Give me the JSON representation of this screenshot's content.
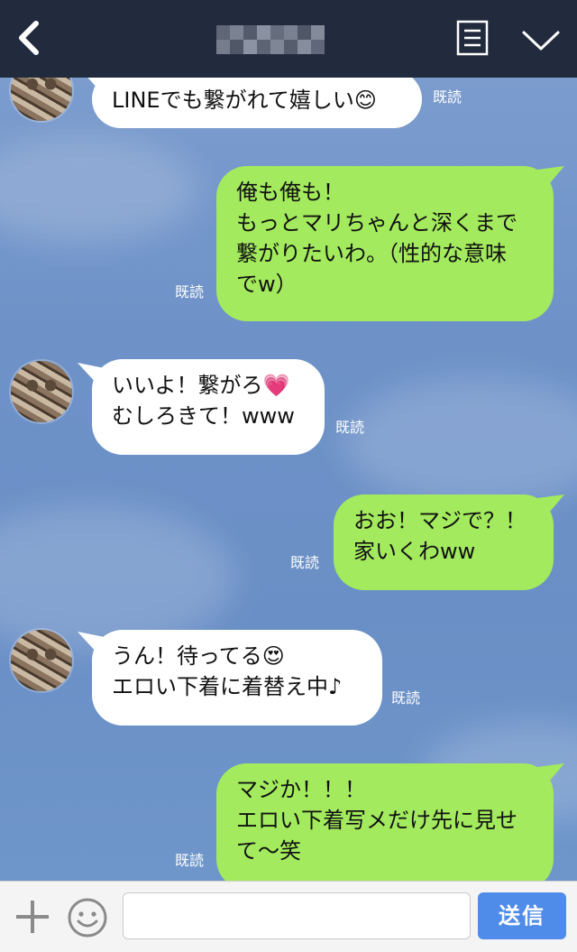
{
  "header": {
    "title": "",
    "colors": {
      "background": "#222a3d",
      "icon": "#ffffff"
    },
    "icons": [
      "back-chevron-icon",
      "note-menu-icon",
      "chevron-down-icon"
    ]
  },
  "messages": [
    {
      "side": "in",
      "lines": [
        "LINEでも繋がれて嬉しい😊"
      ],
      "read": "既読"
    },
    {
      "side": "out",
      "lines": [
        "俺も俺も！",
        "もっとマリちゃんと深くまで",
        "繋がりたいわ。（性的な意味",
        "でw）"
      ],
      "read": "既読"
    },
    {
      "side": "in",
      "lines": [
        "いいよ！繋がろ💗",
        "むしろきて！www"
      ],
      "read": "既読"
    },
    {
      "side": "out",
      "lines": [
        "おお！マジで？！",
        "家いくわww"
      ],
      "read": "既読"
    },
    {
      "side": "in",
      "lines": [
        "うん！待ってる😍",
        "エロい下着に着替え中♪"
      ],
      "read": "既読"
    },
    {
      "side": "out",
      "lines": [
        "マジか！！！",
        "エロい下着写メだけ先に見せ",
        "て〜笑"
      ],
      "read": "既読"
    }
  ],
  "input": {
    "placeholder": "",
    "value": ""
  },
  "send_label": "送信",
  "colors": {
    "incoming_bubble": "#ffffff",
    "outgoing_bubble": "#a3ea5e",
    "send_button": "#4f8be9",
    "chat_background": "#6e92c8"
  }
}
